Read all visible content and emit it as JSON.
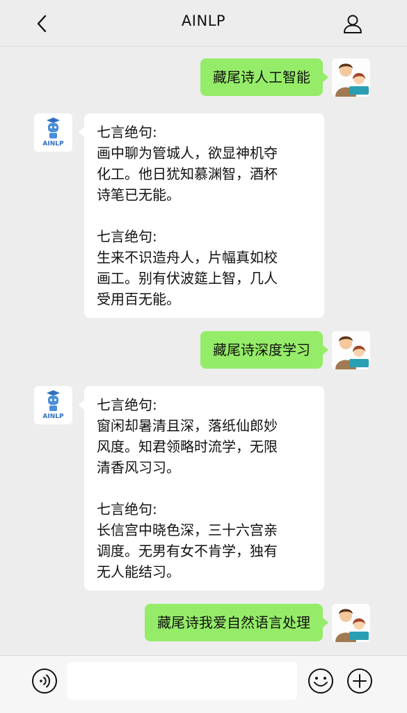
{
  "header": {
    "title": "AINLP"
  },
  "bot": {
    "avatar_label": "AINLP"
  },
  "messages": [
    {
      "from": "user",
      "text": "藏尾诗人工智能"
    },
    {
      "from": "bot",
      "poems": [
        {
          "heading": "七言绝句:",
          "lines": [
            "画中聊为管城人，欲显神机夺",
            "化工。他日犹知慕渊智，酒杯",
            "诗笔已无能。"
          ]
        },
        {
          "heading": "七言绝句:",
          "lines": [
            "生来不识造舟人，片幅真如校",
            "画工。别有伏波筵上智，几人",
            "受用百无能。"
          ]
        }
      ]
    },
    {
      "from": "user",
      "text": "藏尾诗深度学习"
    },
    {
      "from": "bot",
      "poems": [
        {
          "heading": "七言绝句:",
          "lines": [
            "窗闲却暑清且深，落纸仙郎妙",
            "风度。知君领略时流学，无限",
            "清香风习习。"
          ]
        },
        {
          "heading": "七言绝句:",
          "lines": [
            "长信宫中晓色深，三十六宫亲",
            "调度。无男有女不肯学，独有",
            "无人能结习。"
          ]
        }
      ]
    },
    {
      "from": "user",
      "text": "藏尾诗我爱自然语言处理"
    }
  ],
  "input": {
    "value": ""
  },
  "colors": {
    "user_bubble": "#95ec69",
    "bot_bubble": "#ffffff",
    "background": "#ededed"
  }
}
